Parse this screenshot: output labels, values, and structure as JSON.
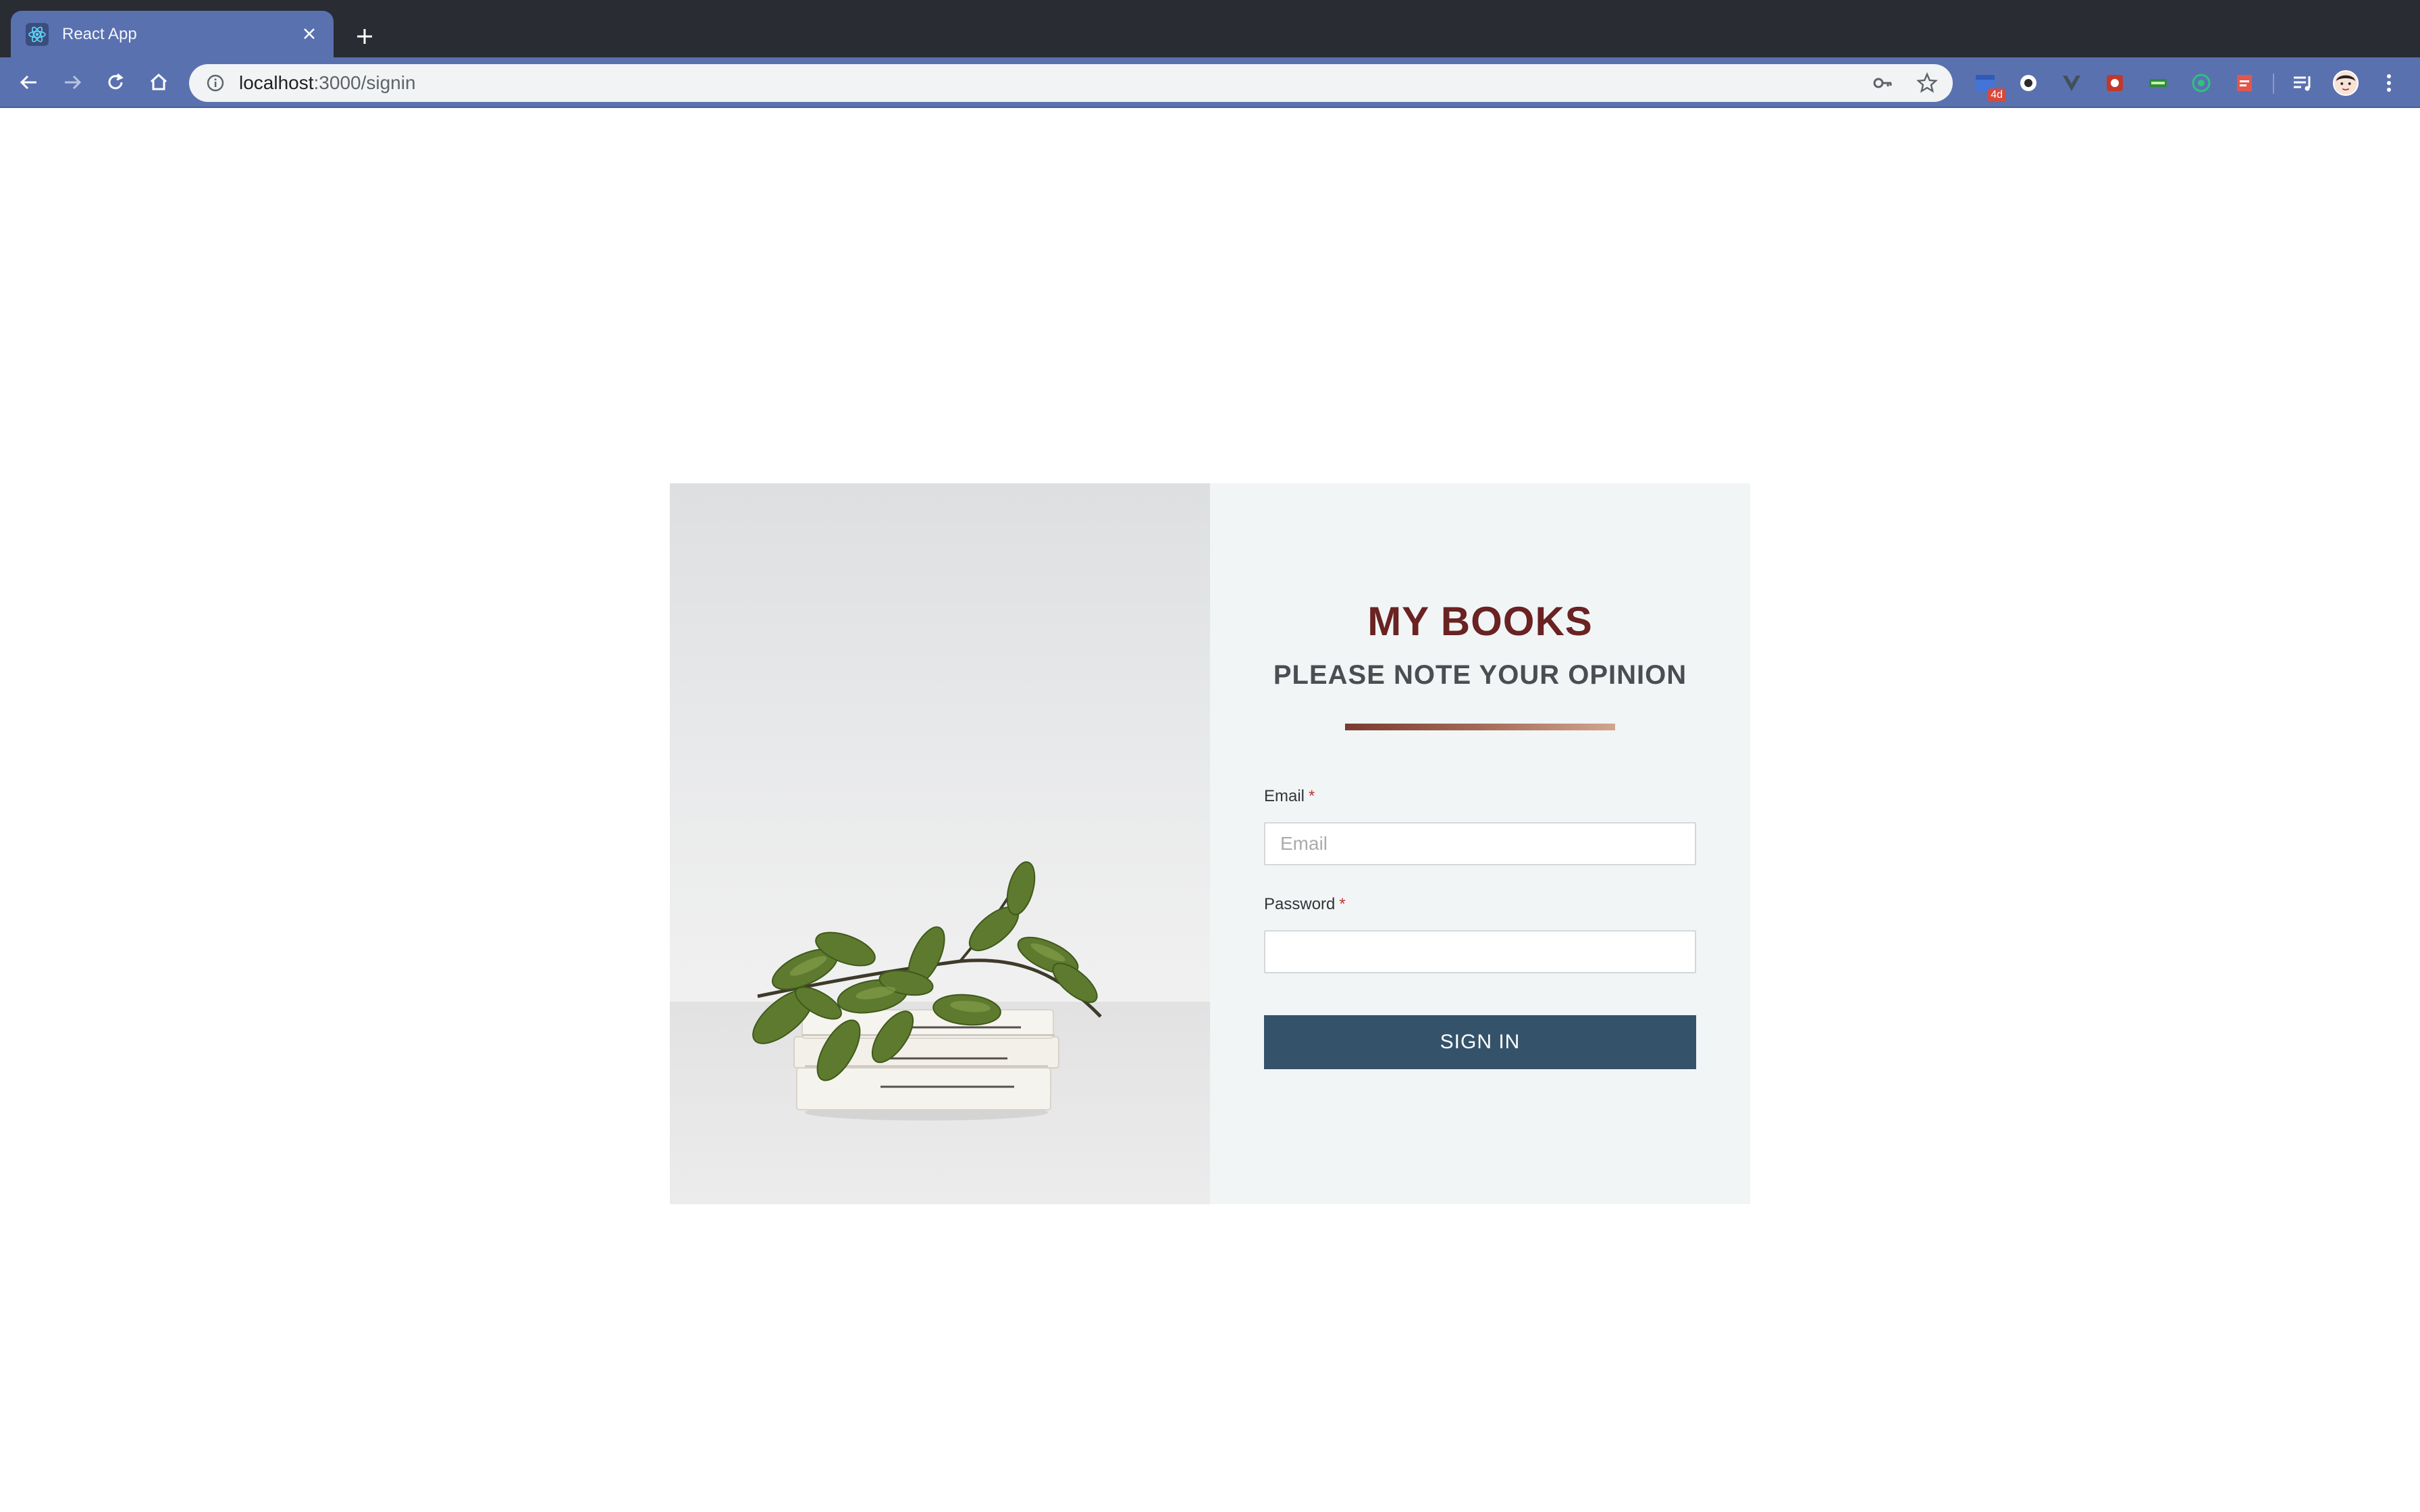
{
  "browser": {
    "tab_title": "React App",
    "url_host": "localhost",
    "url_rest": ":3000/signin",
    "ext_badge": "4d"
  },
  "app": {
    "title": "MY BOOKS",
    "subtitle": "PLEASE NOTE YOUR OPINION"
  },
  "form": {
    "email_label": "Email",
    "email_placeholder": "Email",
    "email_value": "",
    "password_label": "Password",
    "password_value": "",
    "required_mark": "*",
    "submit_label": "SIGN IN"
  },
  "colors": {
    "title": "#6a2222",
    "button": "#34536b",
    "panel": "#f1f5f6",
    "tab": "#5a71b0"
  }
}
